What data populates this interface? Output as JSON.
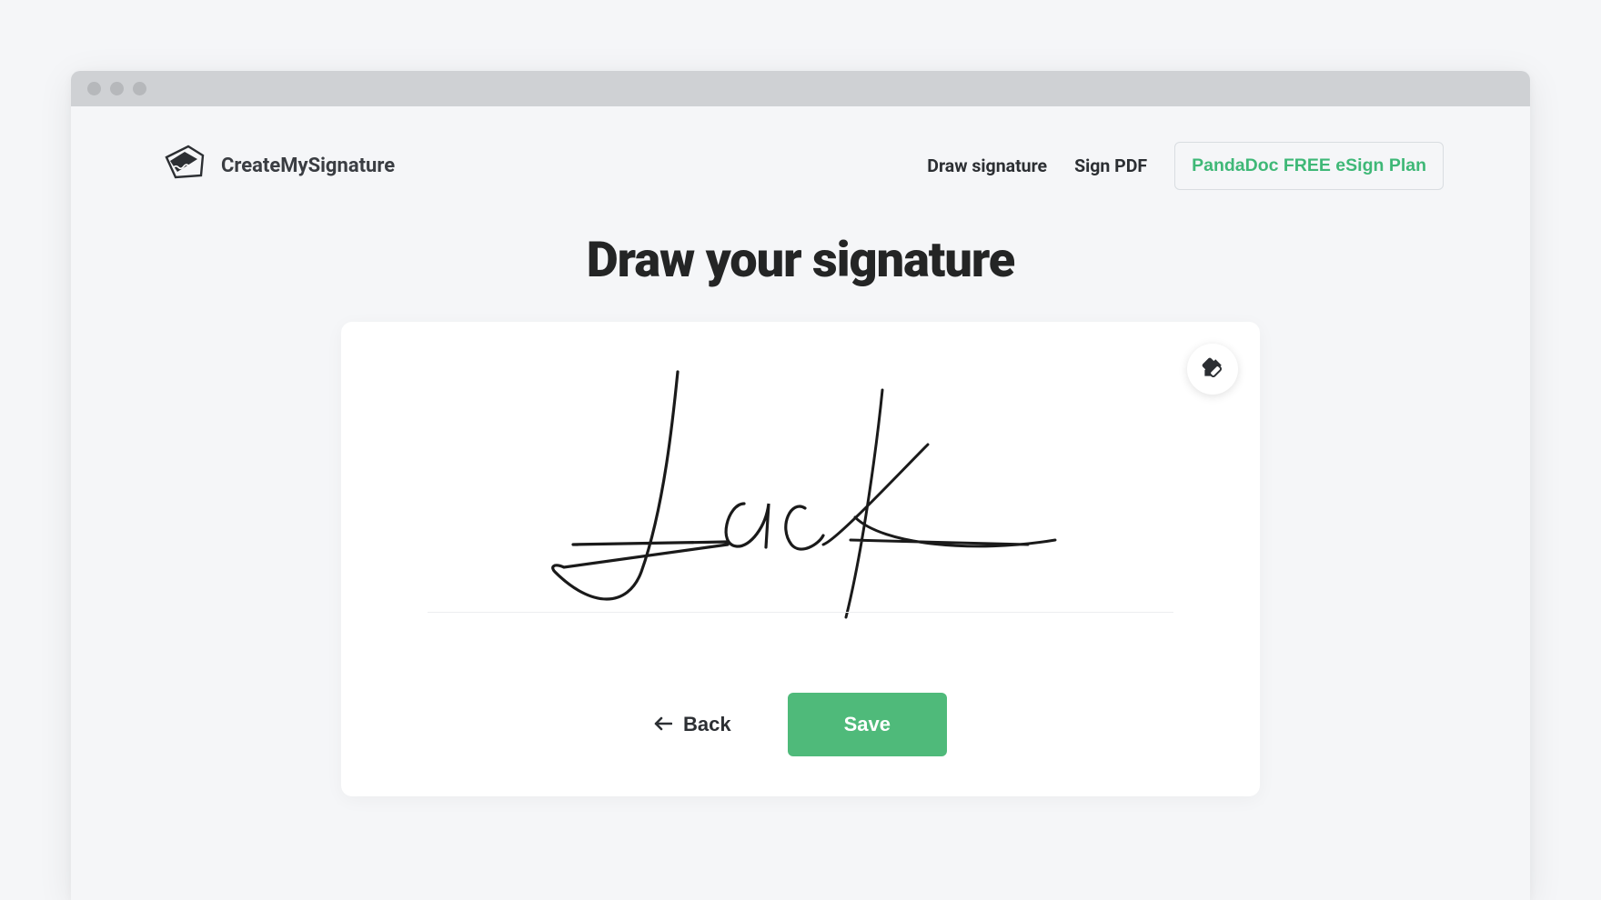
{
  "header": {
    "brand": "CreateMySignature",
    "nav": {
      "draw_signature": "Draw signature",
      "sign_pdf": "Sign PDF"
    },
    "cta": "PandaDoc FREE eSign Plan"
  },
  "main": {
    "title": "Draw your signature",
    "signature_content": "Jack",
    "eraser_icon": "eraser-icon"
  },
  "actions": {
    "back": "Back",
    "save": "Save"
  }
}
